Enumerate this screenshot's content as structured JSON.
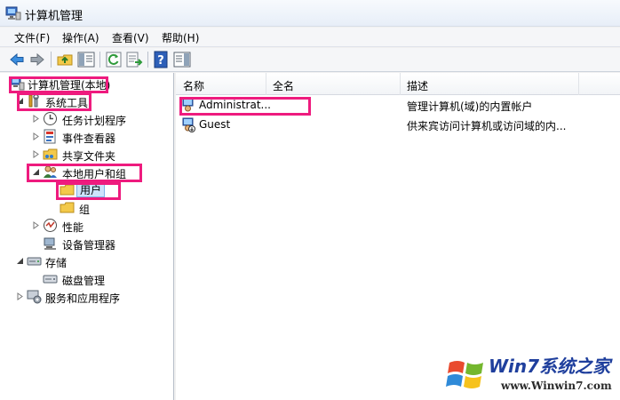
{
  "window": {
    "title": "计算机管理"
  },
  "menu": [
    {
      "label": "文件(F)"
    },
    {
      "label": "操作(A)"
    },
    {
      "label": "查看(V)"
    },
    {
      "label": "帮助(H)"
    }
  ],
  "tree": [
    {
      "label": "计算机管理(本地)",
      "icon": "computer-management-icon"
    },
    {
      "label": "系统工具",
      "icon": "system-tools-icon"
    },
    {
      "label": "任务计划程序",
      "icon": "clock-icon"
    },
    {
      "label": "事件查看器",
      "icon": "event-viewer-icon"
    },
    {
      "label": "共享文件夹",
      "icon": "shared-folder-icon"
    },
    {
      "label": "本地用户和组",
      "icon": "users-group-icon"
    },
    {
      "label": "用户",
      "icon": "folder-icon"
    },
    {
      "label": "组",
      "icon": "folder-icon"
    },
    {
      "label": "性能",
      "icon": "performance-icon"
    },
    {
      "label": "设备管理器",
      "icon": "device-manager-icon"
    },
    {
      "label": "存储",
      "icon": "storage-icon"
    },
    {
      "label": "磁盘管理",
      "icon": "disk-icon"
    },
    {
      "label": "服务和应用程序",
      "icon": "services-icon"
    }
  ],
  "list": {
    "columns": [
      "名称",
      "全名",
      "描述"
    ],
    "rows": [
      {
        "name": "Administrat...",
        "fullname": "",
        "description": "管理计算机(域)的内置帐户"
      },
      {
        "name": "Guest",
        "fullname": "",
        "description": "供来宾访问计算机或访问域的内..."
      }
    ]
  },
  "watermark": {
    "title": "Win7系统之家",
    "url": "www.Winwin7.com"
  },
  "colors": {
    "highlight": "#ee1b7e",
    "accent": "#1f3f9d"
  }
}
